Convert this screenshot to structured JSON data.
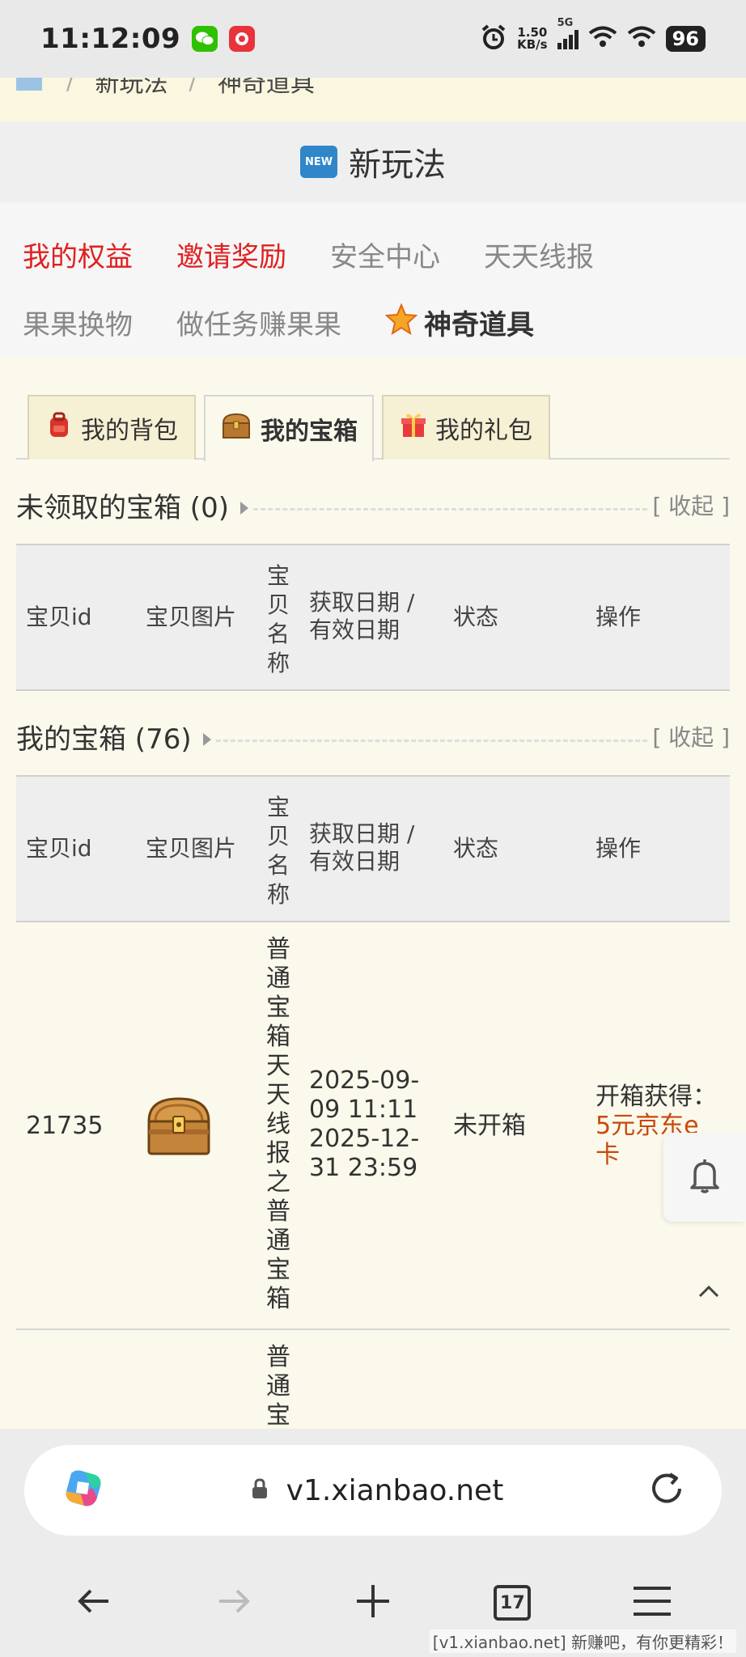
{
  "status_bar": {
    "time": "11:12:09",
    "net_speed_value": "1.50",
    "net_speed_unit": "KB/s",
    "network": "5G",
    "battery": "96"
  },
  "breadcrumb": {
    "items": [
      "新玩法",
      "神奇道具"
    ]
  },
  "header": {
    "badge": "NEW",
    "title": "新玩法"
  },
  "nav": {
    "items": [
      "我的权益",
      "邀请奖励",
      "安全中心",
      "天天线报",
      "果果换物",
      "做任务赚果果",
      "神奇道具"
    ],
    "highlight_color": "#e02020"
  },
  "tabs": {
    "items": [
      "我的背包",
      "我的宝箱",
      "我的礼包"
    ],
    "active": "我的宝箱"
  },
  "unclaimed_section": {
    "title": "未领取的宝箱 (0)",
    "toggle": "[ 收起 ]"
  },
  "my_chest_section": {
    "title": "我的宝箱 (76)",
    "toggle": "[ 收起 ]"
  },
  "table": {
    "headers": {
      "id": "宝贝id",
      "image": "宝贝图片",
      "name": "宝贝名称",
      "date_line1": "获取日期 /",
      "date_line2": "有效日期",
      "status": "状态",
      "action": "操作"
    },
    "rows": [
      {
        "id": "21735",
        "name": "普通宝箱天天线报之普通宝箱",
        "date1": "2025-09-09 11:11",
        "date2": "2025-12-31 23:59",
        "status": "未开箱",
        "action_label": "开箱获得：",
        "reward": "5元京东e卡"
      },
      {
        "name_partial": "普通宝"
      }
    ]
  },
  "browser": {
    "url": "v1.xianbao.net",
    "tab_count": "17"
  },
  "watermark": "[v1.xianbao.net] 新赚吧，有你更精彩！"
}
